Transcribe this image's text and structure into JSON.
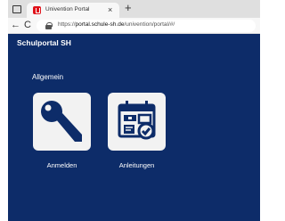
{
  "browser": {
    "tab_title": "Univention Portal",
    "tab_close": "×",
    "new_tab": "+",
    "back": "←",
    "reload": "C",
    "url_prefix": "https://",
    "url_host": "portal.schule-sh.de",
    "url_path": "/univention/portal/#/"
  },
  "page": {
    "site_title": "Schulportal SH",
    "section_title": "Allgemein",
    "tiles": [
      {
        "label": "Anmelden",
        "icon": "key-icon"
      },
      {
        "label": "Anleitungen",
        "icon": "calendar-checklist-icon"
      }
    ]
  },
  "colors": {
    "page_background": "#0d2c69",
    "tile_background": "#f2f2f2",
    "icon_color": "#0d2c69",
    "favicon": "#e0121a"
  }
}
